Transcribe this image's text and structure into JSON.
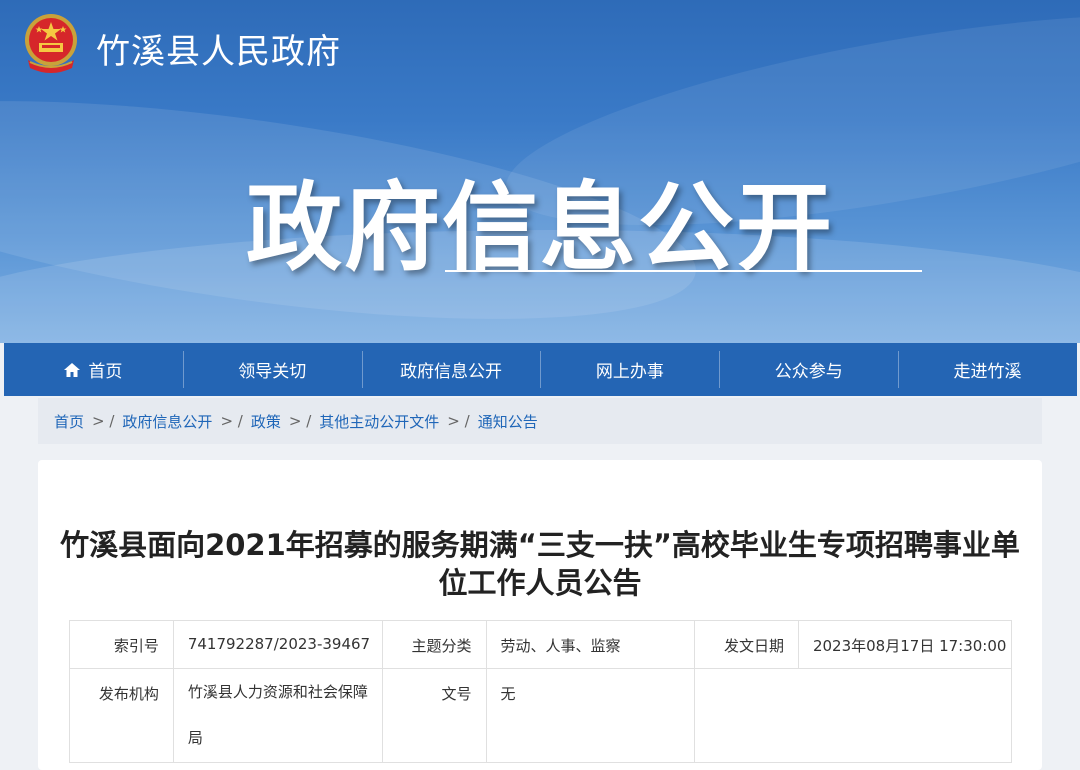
{
  "header": {
    "site_name": "竹溪县人民政府",
    "banner_title": "政府信息公开"
  },
  "nav": {
    "items": [
      {
        "label": "首页",
        "icon": "home-icon"
      },
      {
        "label": "领导关切"
      },
      {
        "label": "政府信息公开"
      },
      {
        "label": "网上办事"
      },
      {
        "label": "公众参与"
      },
      {
        "label": "走进竹溪"
      }
    ]
  },
  "breadcrumb": {
    "items": [
      "首页",
      "政府信息公开",
      "政策",
      "其他主动公开文件",
      "通知公告"
    ],
    "separator": ">"
  },
  "article": {
    "title": "竹溪县面向2021年招募的服务期满“三支一扶”高校毕业生专项招聘事业单位工作人员公告",
    "meta": {
      "index_label": "索引号",
      "index_value": "741792287/2023-39467",
      "topic_label": "主题分类",
      "topic_value": "劳动、人事、监察",
      "date_label": "发文日期",
      "date_value": "2023年08月17日 17:30:00",
      "publisher_label": "发布机构",
      "publisher_value": "竹溪县人力资源和社会保障局",
      "docno_label": "文号",
      "docno_value": "无"
    }
  },
  "colors": {
    "nav_bg": "#2465b4",
    "link": "#1f66b8",
    "banner_top": "#2e6bb8"
  }
}
